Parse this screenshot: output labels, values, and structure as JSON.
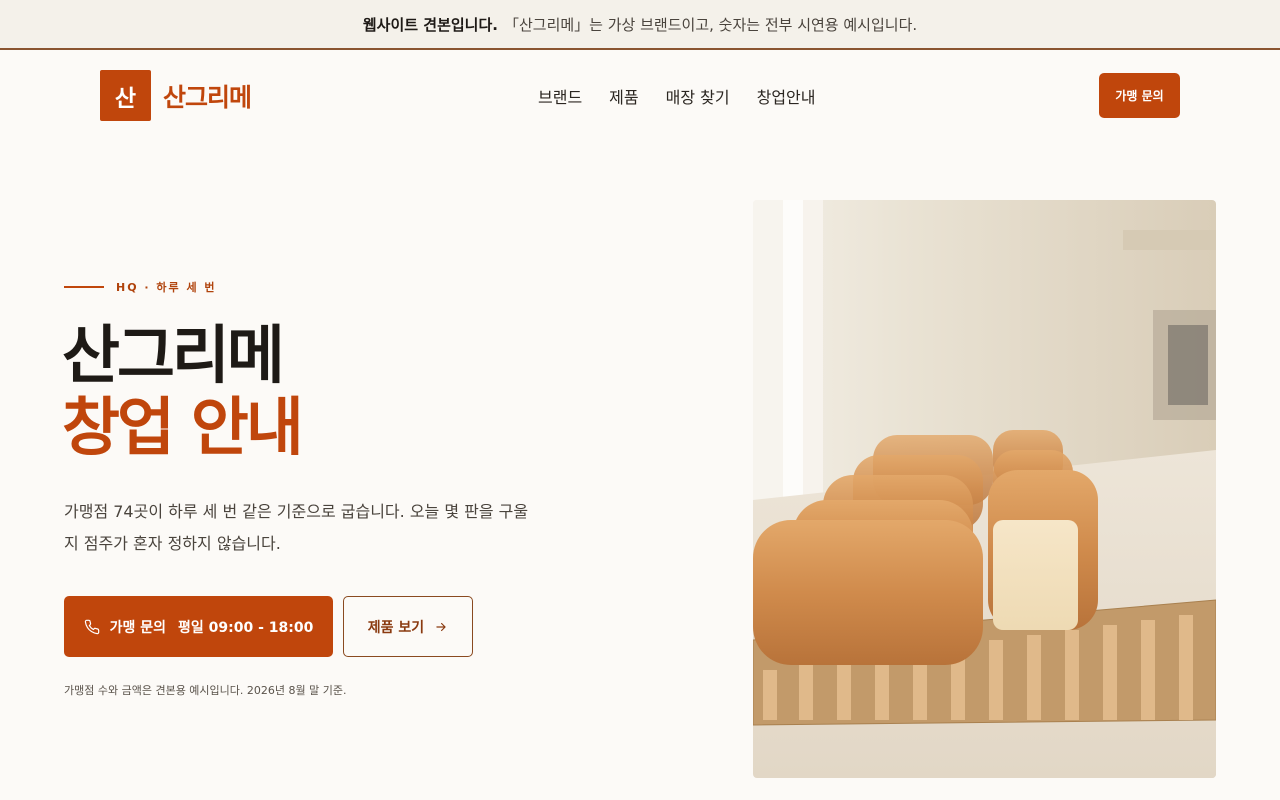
{
  "notice": {
    "bold": "웹사이트 견본입니다.",
    "text": "「산그리메」는 가상 브랜드이고, 숫자는 전부 시연용 예시입니다."
  },
  "header": {
    "logo_mark": "산",
    "logo_text": "산그리메",
    "nav": [
      "브랜드",
      "제품",
      "매장 찾기",
      "창업안내"
    ],
    "cta": "가맹 문의"
  },
  "hero": {
    "eyebrow": "HQ · 하루 세 번",
    "title_line1": "산그리메",
    "title_line2": "창업 안내",
    "description": "가맹점 74곳이 하루 세 번 같은 기준으로 굽습니다. 오늘 몇 판을 구울지 점주가 혼자 정하지 않습니다.",
    "primary_button": {
      "label": "가맹 문의",
      "hours": "평일 09:00 - 18:00",
      "icon": "phone-icon"
    },
    "secondary_button": {
      "label": "제품 보기",
      "icon": "arrow-right-icon"
    },
    "footnote": "가맹점 수와 금액은 견본용 예시입니다. 2026년 8월 말 기준.",
    "image": "bread-loaves-photo"
  },
  "colors": {
    "accent": "#c0460c",
    "background": "#fcfaf7",
    "notice_bg": "#f4f1ea"
  }
}
